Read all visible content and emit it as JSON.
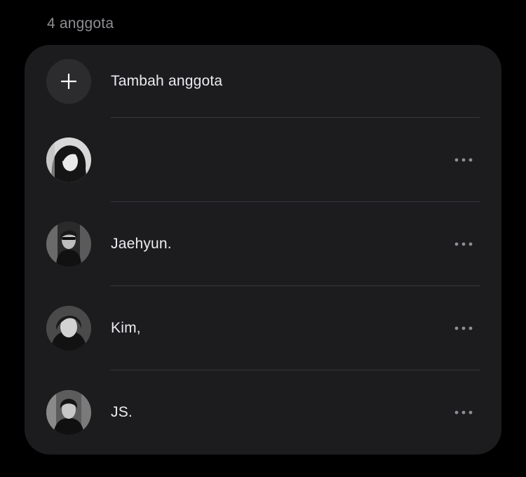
{
  "header": {
    "member_count": "4 anggota"
  },
  "add_member": {
    "label": "Tambah anggota",
    "icon": "plus-icon"
  },
  "members": [
    {
      "name": "",
      "avatar": "avatar-photo-1",
      "more_icon": "more-horizontal-icon"
    },
    {
      "name": "Jaehyun.",
      "avatar": "avatar-photo-2",
      "more_icon": "more-horizontal-icon"
    },
    {
      "name": "Kim,",
      "avatar": "avatar-photo-3",
      "more_icon": "more-horizontal-icon"
    },
    {
      "name": "JS.",
      "avatar": "avatar-photo-4",
      "more_icon": "more-horizontal-icon"
    }
  ],
  "colors": {
    "background": "#000000",
    "card": "#1c1c1e",
    "primary_text": "#ececf0",
    "secondary_text": "#8e8e93",
    "divider": "#38383c"
  }
}
